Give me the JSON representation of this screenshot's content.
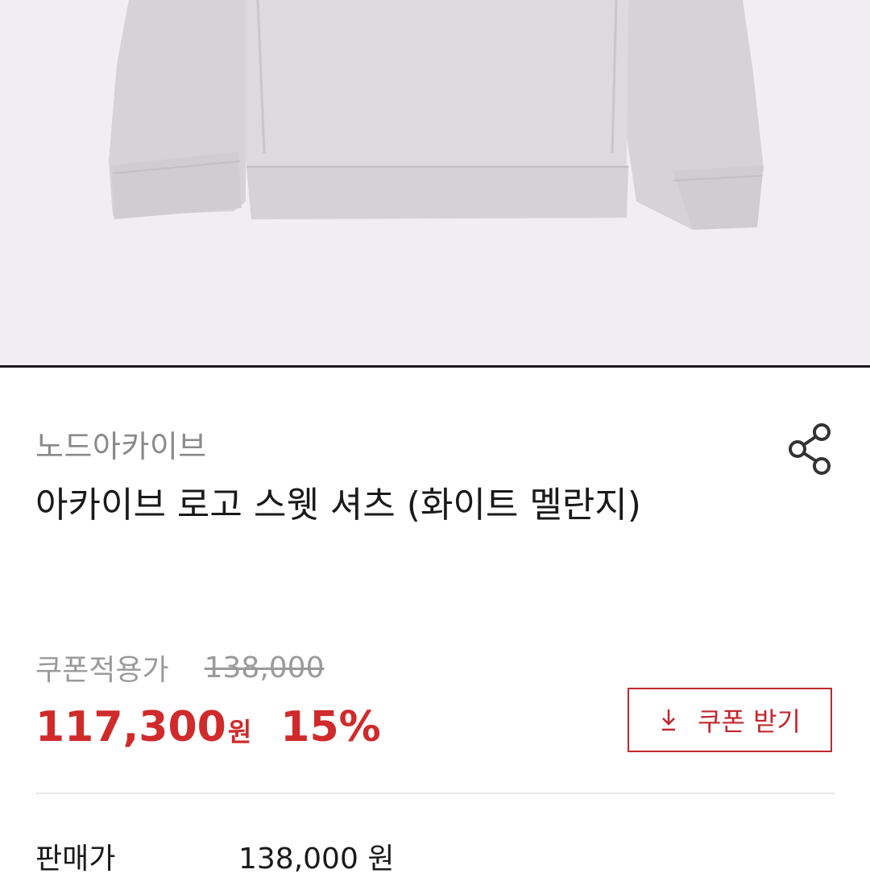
{
  "product": {
    "brand": "노드아카이브",
    "title": "아카이브 로고 스웻 셔츠 (화이트 멜란지)",
    "image_alt": "회색 스웻 셔츠 이미지"
  },
  "pricing": {
    "coupon_label": "쿠폰적용가",
    "original_price": "138,000",
    "coupon_price": "117,300",
    "currency": "원",
    "discount": "15%",
    "coupon_button_label": "쿠폰 받기",
    "sale_label": "판매가",
    "sale_price": "138,000 원"
  },
  "icons": {
    "share": "share-icon",
    "download": "download-arrow-icon"
  },
  "colors": {
    "accent_red": "#d02a2a",
    "coupon_border": "#c0282d",
    "muted_text": "#8a8a8a",
    "hero_bg": "#f1eef1"
  }
}
